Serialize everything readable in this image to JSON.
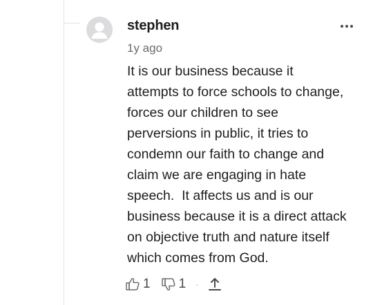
{
  "comment": {
    "username": "stephen",
    "timestamp": "1y ago",
    "body": "It is our business because it\nattempts to force schools to change,\nforces our children to see\nperversions in public, it tries to\ncondemn our faith to change and\nclaim we are engaging in hate\nspeech.  It affects us and is our\nbusiness because it is a direct attack\non objective truth and nature itself\nwhich comes from God.",
    "likes": "1",
    "dislikes": "1",
    "separator": "·",
    "icons": {
      "avatar": "user-avatar-icon",
      "more": "more-options-icon",
      "like": "thumbs-up-icon",
      "dislike": "thumbs-down-icon",
      "share": "share-icon"
    }
  }
}
